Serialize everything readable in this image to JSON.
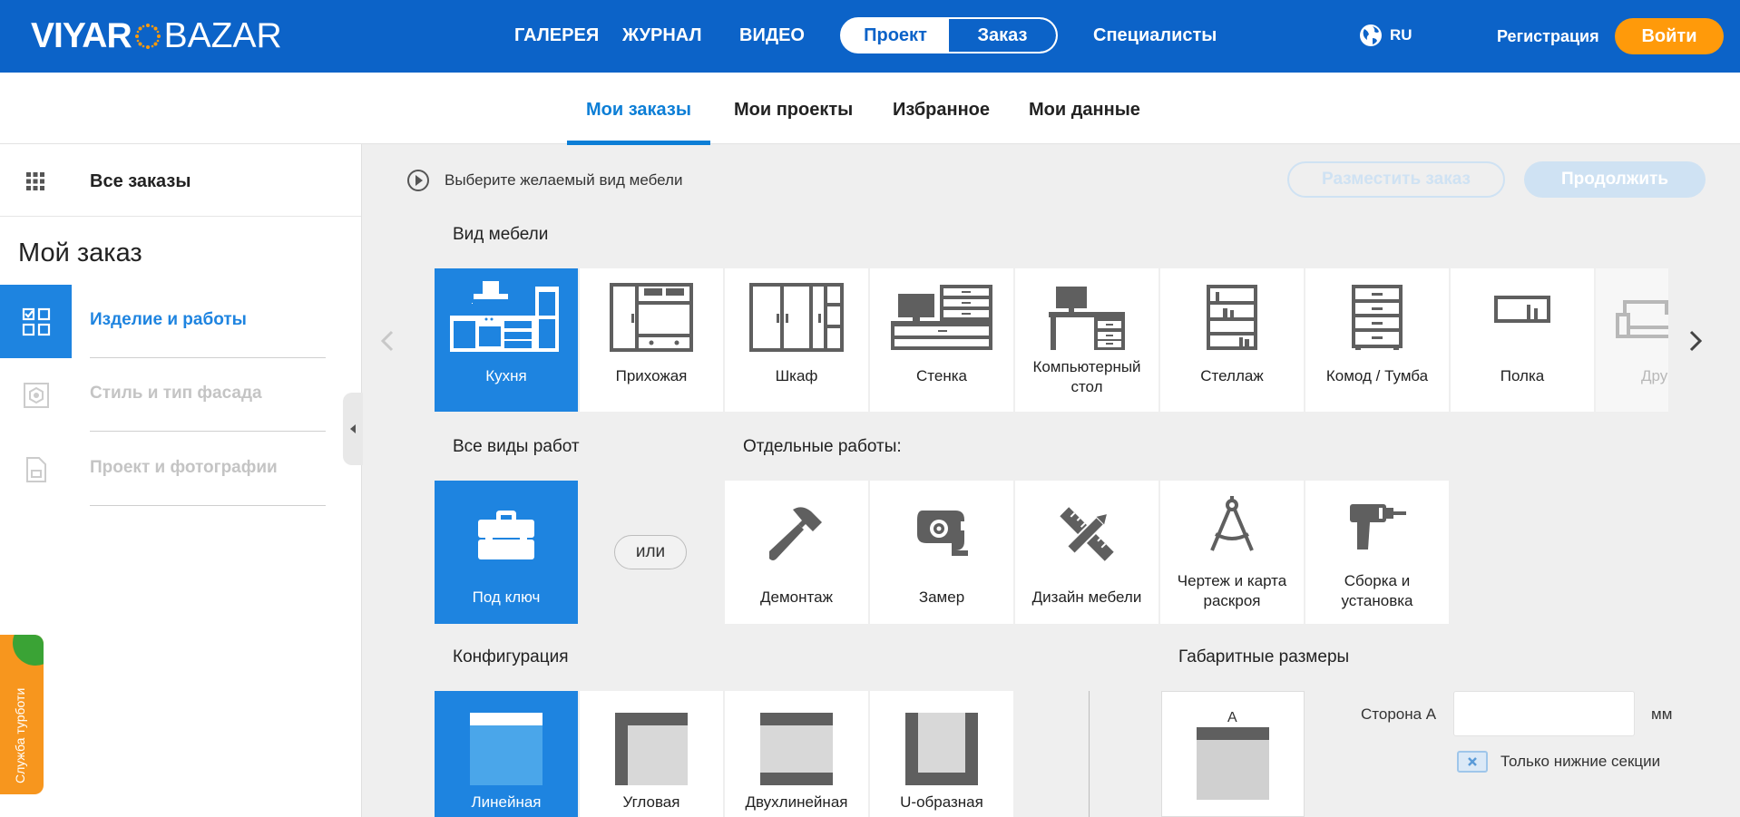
{
  "header": {
    "logo_part1": "VIYAR",
    "logo_part2": "BAZAR",
    "nav": [
      "ГАЛЕРЕЯ",
      "ЖУРНАЛ",
      "ВИДЕО"
    ],
    "toggle": [
      "Проект",
      "Заказ"
    ],
    "specialists": "Специалисты",
    "lang": "RU",
    "register": "Регистрация",
    "login": "Войти"
  },
  "subnav": {
    "tabs": [
      "Мои заказы",
      "Мои проекты",
      "Избранное",
      "Мои данные"
    ],
    "active_tab": "Мои заказы"
  },
  "sidebar": {
    "all_orders": "Все заказы",
    "title": "Мой заказ",
    "steps": [
      "Изделие и работы",
      "Стиль и тип фасада",
      "Проект и фотографии"
    ],
    "turbo": "Служба турботи"
  },
  "main": {
    "hint": "Выберите желаемый вид мебели",
    "place_order": "Разместить заказ",
    "continue": "Продолжить",
    "furniture_label": "Вид мебели",
    "furniture": [
      "Кухня",
      "Прихожая",
      "Шкаф",
      "Стенка",
      "Компьютерный стол",
      "Стеллаж",
      "Комод / Тумба",
      "Полка",
      "Дру"
    ],
    "all_works_label": "Все виды работ",
    "separate_works_label": "Отдельные работы:",
    "turnkey": "Под ключ",
    "or": "или",
    "works": [
      "Демонтаж",
      "Замер",
      "Дизайн мебели",
      "Чертеж и карта раскроя",
      "Сборка и установка"
    ],
    "config_label": "Конфигурация",
    "configs": [
      "Линейная",
      "Угловая",
      "Двухлинейная",
      "U-образная"
    ],
    "dims_label": "Габаритные размеры",
    "side_a_letter": "A",
    "side_a_label": "Сторона А",
    "side_a_value": "",
    "unit": "мм",
    "only_lower": "Только нижние секции"
  },
  "colors": {
    "brand_blue": "#0c63c8",
    "active_blue": "#1e84e0",
    "orange": "#ff9a0a",
    "icon_gray": "#5f5f5f"
  }
}
